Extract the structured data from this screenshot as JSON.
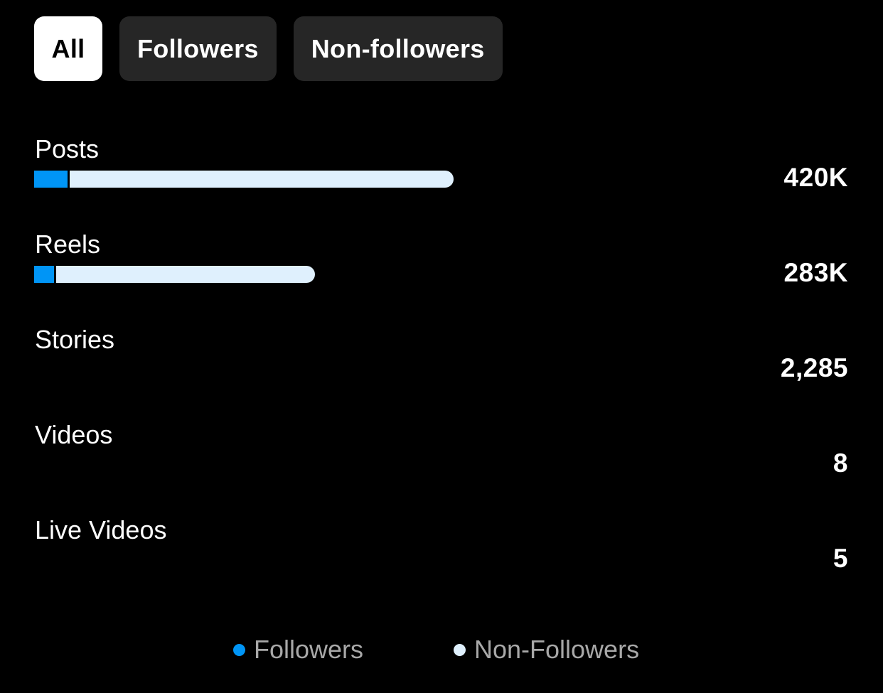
{
  "tabs": [
    {
      "label": "All",
      "active": true
    },
    {
      "label": "Followers",
      "active": false
    },
    {
      "label": "Non-followers",
      "active": false
    }
  ],
  "metrics": [
    {
      "label": "Posts",
      "value": "420K",
      "followers_share": 0.08,
      "bar_fraction": 1.0
    },
    {
      "label": "Reels",
      "value": "283K",
      "followers_share": 0.07,
      "bar_fraction": 0.67
    },
    {
      "label": "Stories",
      "value": "2,285",
      "followers_share": 0,
      "bar_fraction": 0
    },
    {
      "label": "Videos",
      "value": "8",
      "followers_share": 0,
      "bar_fraction": 0
    },
    {
      "label": "Live Videos",
      "value": "5",
      "followers_share": 0,
      "bar_fraction": 0
    }
  ],
  "legend": {
    "followers": {
      "label": "Followers",
      "color": "#0095f6"
    },
    "non_followers": {
      "label": "Non-Followers",
      "color": "#dff0fd"
    }
  }
}
